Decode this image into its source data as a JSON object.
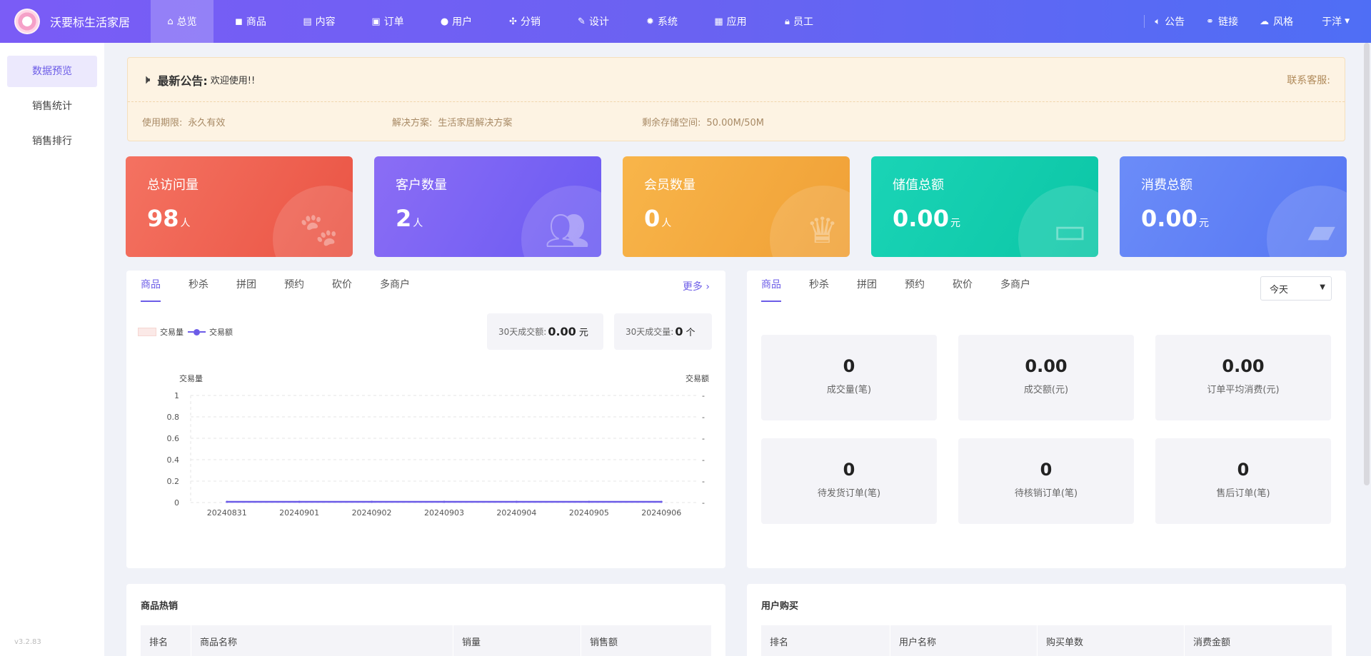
{
  "brand": {
    "name": "沃要标生活家居"
  },
  "nav": [
    {
      "label": "总览",
      "icon": "⌂"
    },
    {
      "label": "商品",
      "icon": "◼"
    },
    {
      "label": "内容",
      "icon": "▤"
    },
    {
      "label": "订单",
      "icon": "▣"
    },
    {
      "label": "用户",
      "icon": "●"
    },
    {
      "label": "分销",
      "icon": "✣"
    },
    {
      "label": "设计",
      "icon": "✎"
    },
    {
      "label": "系统",
      "icon": "✹"
    },
    {
      "label": "应用",
      "icon": "▦"
    },
    {
      "label": "员工",
      "icon": "🔒︎"
    }
  ],
  "topright": {
    "notice": "公告",
    "notice_icon": "🔈︎",
    "link": "链接",
    "link_icon": "⚭",
    "style": "风格",
    "style_icon": "☁︎",
    "user": "于洋"
  },
  "sidebar": [
    {
      "label": "数据预览"
    },
    {
      "label": "销售统计"
    },
    {
      "label": "销售排行"
    }
  ],
  "version": "v3.2.83",
  "notice": {
    "title": "最新公告:",
    "message": "欢迎使用!!",
    "customer_service": "联系客服:",
    "period_label": "使用期限:",
    "period_value": "永久有效",
    "solution_label": "解决方案:",
    "solution_value": "生活家居解决方案",
    "storage_label": "剩余存储空间:",
    "storage_value": "50.00M/50M"
  },
  "cards": [
    {
      "title": "总访问量",
      "value": "98",
      "unit": "人",
      "icon": "paw-icon",
      "color": "#ee5b4a"
    },
    {
      "title": "客户数量",
      "value": "2",
      "unit": "人",
      "icon": "users-icon",
      "color": "#7460f3"
    },
    {
      "title": "会员数量",
      "value": "0",
      "unit": "人",
      "icon": "crown-icon",
      "color": "#f4aa3f"
    },
    {
      "title": "储值总额",
      "value": "0.00",
      "unit": "元",
      "icon": "card-icon",
      "color": "#10ccac"
    },
    {
      "title": "消费总额",
      "value": "0.00",
      "unit": "元",
      "icon": "wallet-icon",
      "color": "#5e80f5"
    }
  ],
  "left_panel": {
    "tabs": [
      "商品",
      "秒杀",
      "拼团",
      "预约",
      "砍价",
      "多商户"
    ],
    "more": "更多 ›",
    "stat1_label": "30天成交额:",
    "stat1_value": "0.00",
    "stat1_unit": "元",
    "stat2_label": "30天成交量:",
    "stat2_value": "0",
    "stat2_unit": "个"
  },
  "chart_data": {
    "type": "line",
    "categories": [
      "20240831",
      "20240901",
      "20240902",
      "20240903",
      "20240904",
      "20240905",
      "20240906"
    ],
    "series": [
      {
        "name": "交易量",
        "type": "bar",
        "axis": "left",
        "values": [
          0,
          0,
          0,
          0,
          0,
          0,
          0
        ]
      },
      {
        "name": "交易额",
        "type": "line",
        "axis": "right",
        "values": [
          0,
          0,
          0,
          0,
          0,
          0,
          0
        ]
      }
    ],
    "ylabel": "交易量",
    "ylabel_right": "交易额",
    "ylim": [
      0,
      1
    ],
    "yticks": [
      "0",
      "0.2",
      "0.4",
      "0.6",
      "0.8",
      "1"
    ],
    "yticks_right": [
      "-",
      "-",
      "-",
      "-",
      "-",
      "-"
    ],
    "legend": "top-left",
    "grid": true,
    "colors": {
      "bar": "#fbe9e7",
      "line": "#6c5ce7"
    }
  },
  "right_panel": {
    "tabs": [
      "商品",
      "秒杀",
      "拼团",
      "预约",
      "砍价",
      "多商户"
    ],
    "period": "今天",
    "kpis": [
      {
        "value": "0",
        "label": "成交量(笔)"
      },
      {
        "value": "0.00",
        "label": "成交额(元)"
      },
      {
        "value": "0.00",
        "label": "订单平均消费(元)"
      },
      {
        "value": "0",
        "label": "待发货订单(笔)"
      },
      {
        "value": "0",
        "label": "待核销订单(笔)"
      },
      {
        "value": "0",
        "label": "售后订单(笔)"
      }
    ]
  },
  "hot_goods": {
    "title": "商品热销",
    "columns": [
      "排名",
      "商品名称",
      "销量",
      "销售额"
    ]
  },
  "user_buy": {
    "title": "用户购买",
    "columns": [
      "排名",
      "用户名称",
      "购买单数",
      "消费金额"
    ]
  }
}
